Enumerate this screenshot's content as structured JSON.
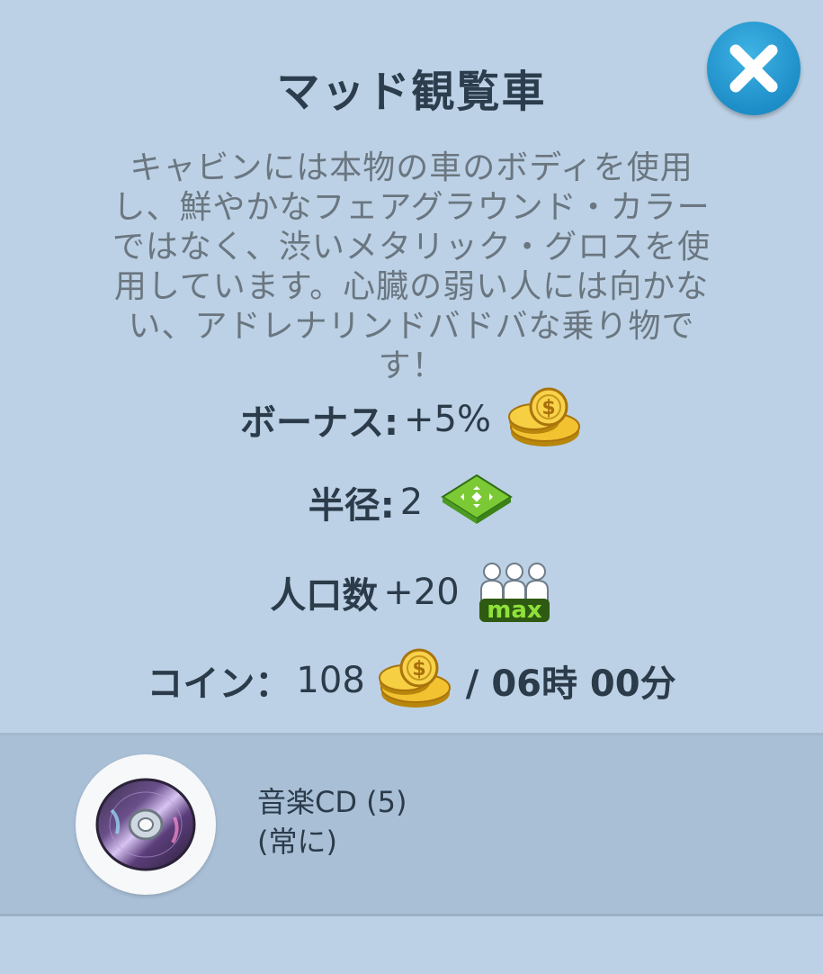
{
  "dialog": {
    "title": "マッド観覧車",
    "description": "キャビンには本物の車のボディを使用し、鮮やかなフェアグラウンド・カラーではなく、渋いメタリック・グロスを使用しています。心臓の弱い人には向かない、アドレナリンドバドバな乗り物です！",
    "close_icon": "close-icon"
  },
  "stats": {
    "bonus": {
      "label": "ボーナス:",
      "value": "+5%",
      "icon": "coin-stack-icon"
    },
    "radius": {
      "label": "半径:",
      "value": "2",
      "icon": "area-tile-icon"
    },
    "population": {
      "label": "人口数",
      "value": "+20",
      "icon": "population-max-icon",
      "icon_text": "max"
    },
    "coins": {
      "label": "コイン：",
      "value": "108",
      "icon": "coin-stack-icon",
      "rate": "/ 06時 00分"
    }
  },
  "item": {
    "name": "音楽CD (5)",
    "subtitle": "(常に)",
    "icon": "music-cd-icon"
  },
  "colors": {
    "background": "#bcd1e5",
    "bottom_strip": "#a9bfd6",
    "close_button": "#1e8ec8",
    "text_dark": "#2b3b4a",
    "text_muted": "#6a7680"
  }
}
